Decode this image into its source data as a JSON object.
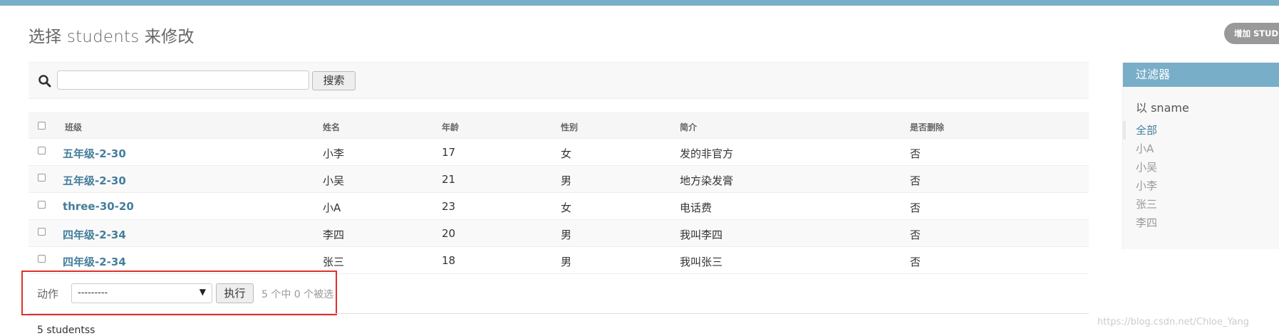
{
  "page": {
    "title": "选择 students 来修改",
    "add_label": "增加 STUDENTS"
  },
  "search": {
    "value": "",
    "placeholder": "",
    "button_label": "搜索"
  },
  "table": {
    "headers": [
      "班级",
      "姓名",
      "年龄",
      "性别",
      "简介",
      "是否删除"
    ],
    "rows": [
      [
        "五年级-2-30",
        "小李",
        "17",
        "女",
        "发的非官方",
        "否"
      ],
      [
        "五年级-2-30",
        "小吴",
        "21",
        "男",
        "地方染发膏",
        "否"
      ],
      [
        "three-30-20",
        "小A",
        "23",
        "女",
        "电话费",
        "否"
      ],
      [
        "四年级-2-34",
        "李四",
        "20",
        "男",
        "我叫李四",
        "否"
      ],
      [
        "四年级-2-34",
        "张三",
        "18",
        "男",
        "我叫张三",
        "否"
      ]
    ]
  },
  "actions": {
    "label": "动作",
    "selected_option": "---------",
    "run_label": "执行",
    "selection_text": "5 个中 0 个被选"
  },
  "paginator": {
    "text": "5 studentss"
  },
  "filter": {
    "title": "过滤器",
    "by": "以 sname",
    "items": [
      "全部",
      "小A",
      "小吴",
      "小李",
      "张三",
      "李四"
    ]
  },
  "watermark": "https://blog.csdn.net/Chloe_Yang",
  "icons": {
    "search": "search-icon",
    "dropdown": "triangle-down-icon"
  },
  "colors": {
    "accent": "#79aec8",
    "link": "#447e9b",
    "highlight_box": "#e0302a"
  }
}
